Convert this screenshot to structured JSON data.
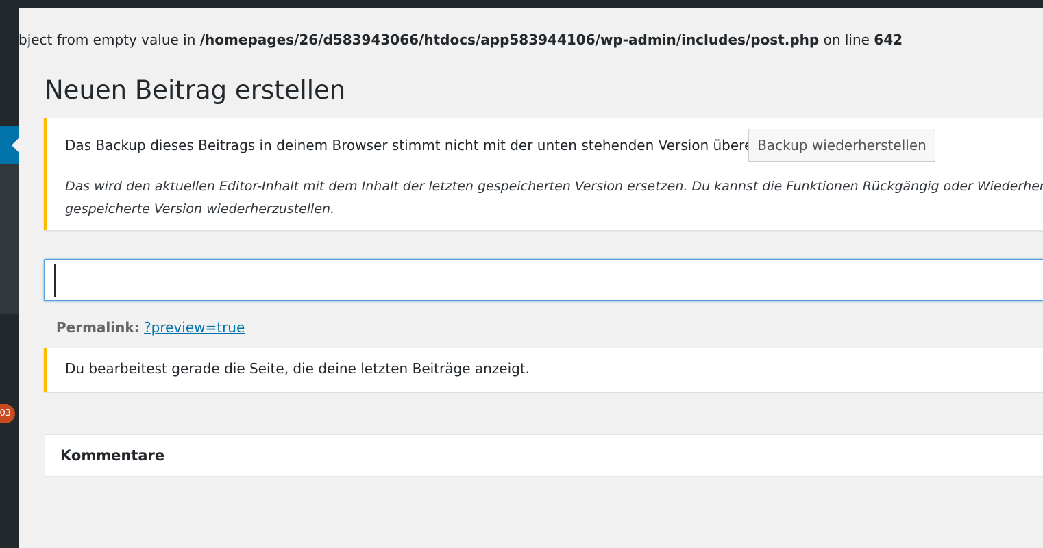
{
  "php_notice": {
    "prefix": "bject from empty value in ",
    "path": "/homepages/26/d583943066/htdocs/app583944106/wp-admin/includes/post.php",
    "middle": " on line ",
    "line": "642"
  },
  "page": {
    "title": "Neuen Beitrag erstellen"
  },
  "backup_notice": {
    "message": "Das Backup dieses Beitrags in deinem Browser stimmt nicht mit der unten stehenden Version überein.",
    "button_label": "Backup wiederherstellen",
    "hint_line1": "Das wird den aktuellen Editor-Inhalt mit dem Inhalt der letzten gespeicherten Version ersetzen. Du kannst die Funktionen Rückgängig oder Wiederher",
    "hint_line2": "gespeicherte Version wiederherzustellen."
  },
  "title_field": {
    "value": "",
    "placeholder": ""
  },
  "permalink": {
    "label": "Permalink:",
    "link_text": "?preview=true"
  },
  "page_notice": {
    "message": "Du bearbeitest gerade die Seite, die deine letzten Beiträge anzeigt."
  },
  "comments": {
    "heading": "Kommentare"
  },
  "sidebar": {
    "badge_text": "03"
  },
  "colors": {
    "admin_bar": "#23282d",
    "accent": "#0073aa",
    "warning": "#ffb900",
    "badge": "#ca4a1f"
  }
}
